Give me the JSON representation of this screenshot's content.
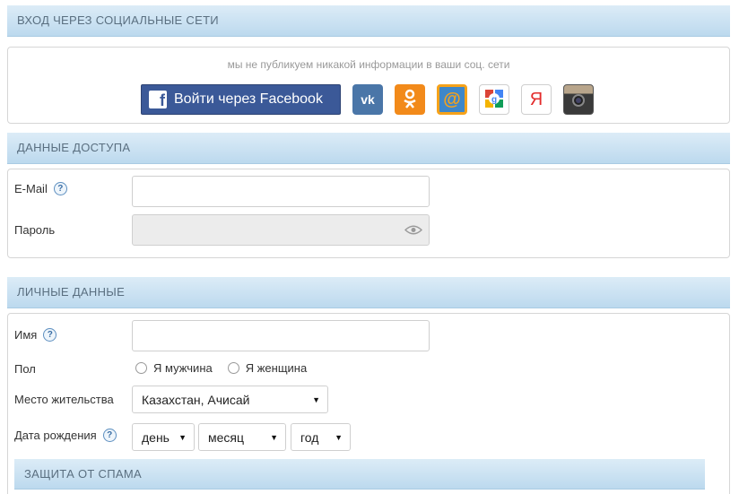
{
  "social": {
    "header": "ВХОД ЧЕРЕЗ СОЦИАЛЬНЫЕ СЕТИ",
    "notice": "мы не публикуем никакой информации в ваши соц. сети",
    "facebook_label": "Войти через Facebook",
    "icons": [
      "facebook-icon",
      "vk-icon",
      "odnoklassniki-icon",
      "mailru-icon",
      "google-plus-icon",
      "yandex-icon",
      "instagram-icon"
    ],
    "vk_text": "vk",
    "mail_text": "@",
    "yandex_text": "Я"
  },
  "access": {
    "header": "ДАННЫЕ ДОСТУПА",
    "email_label": "E-Mail",
    "email_value": "",
    "password_label": "Пароль",
    "password_value": ""
  },
  "personal": {
    "header": "ЛИЧНЫЕ ДАННЫЕ",
    "name_label": "Имя",
    "name_value": "",
    "gender_label": "Пол",
    "gender_male": "Я мужчина",
    "gender_female": "Я женщина",
    "location_label": "Место жительства",
    "location_value": "Казахстан, Ачисай",
    "birthdate_label": "Дата рождения",
    "day": "день",
    "month": "месяц",
    "year": "год"
  },
  "spam": {
    "header": "ЗАЩИТА ОТ СПАМА"
  },
  "help_glyph": "?",
  "colors": {
    "header_bg": "#c8e1f2",
    "facebook": "#3b5998",
    "vk": "#4a76a8",
    "ok": "#f28a1a",
    "yandex": "#e32b2b"
  }
}
